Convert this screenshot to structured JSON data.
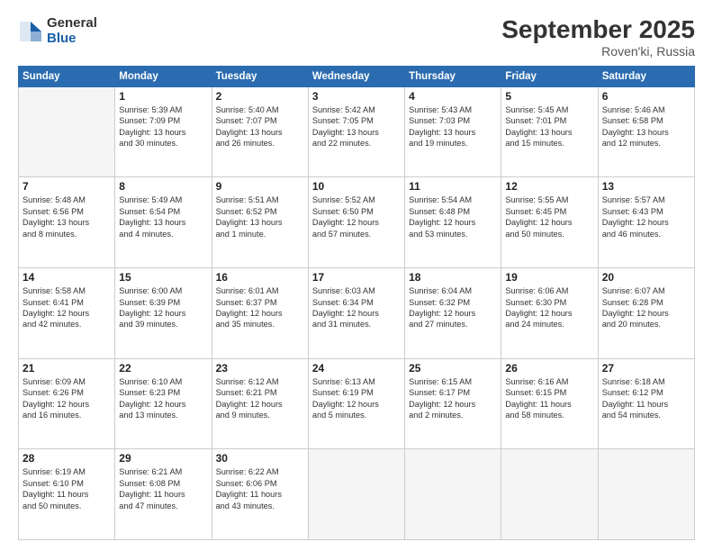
{
  "header": {
    "logo_general": "General",
    "logo_blue": "Blue",
    "month_title": "September 2025",
    "location": "Roven'ki, Russia"
  },
  "days_of_week": [
    "Sunday",
    "Monday",
    "Tuesday",
    "Wednesday",
    "Thursday",
    "Friday",
    "Saturday"
  ],
  "weeks": [
    [
      {
        "day": "",
        "info": ""
      },
      {
        "day": "1",
        "info": "Sunrise: 5:39 AM\nSunset: 7:09 PM\nDaylight: 13 hours\nand 30 minutes."
      },
      {
        "day": "2",
        "info": "Sunrise: 5:40 AM\nSunset: 7:07 PM\nDaylight: 13 hours\nand 26 minutes."
      },
      {
        "day": "3",
        "info": "Sunrise: 5:42 AM\nSunset: 7:05 PM\nDaylight: 13 hours\nand 22 minutes."
      },
      {
        "day": "4",
        "info": "Sunrise: 5:43 AM\nSunset: 7:03 PM\nDaylight: 13 hours\nand 19 minutes."
      },
      {
        "day": "5",
        "info": "Sunrise: 5:45 AM\nSunset: 7:01 PM\nDaylight: 13 hours\nand 15 minutes."
      },
      {
        "day": "6",
        "info": "Sunrise: 5:46 AM\nSunset: 6:58 PM\nDaylight: 13 hours\nand 12 minutes."
      }
    ],
    [
      {
        "day": "7",
        "info": "Sunrise: 5:48 AM\nSunset: 6:56 PM\nDaylight: 13 hours\nand 8 minutes."
      },
      {
        "day": "8",
        "info": "Sunrise: 5:49 AM\nSunset: 6:54 PM\nDaylight: 13 hours\nand 4 minutes."
      },
      {
        "day": "9",
        "info": "Sunrise: 5:51 AM\nSunset: 6:52 PM\nDaylight: 13 hours\nand 1 minute."
      },
      {
        "day": "10",
        "info": "Sunrise: 5:52 AM\nSunset: 6:50 PM\nDaylight: 12 hours\nand 57 minutes."
      },
      {
        "day": "11",
        "info": "Sunrise: 5:54 AM\nSunset: 6:48 PM\nDaylight: 12 hours\nand 53 minutes."
      },
      {
        "day": "12",
        "info": "Sunrise: 5:55 AM\nSunset: 6:45 PM\nDaylight: 12 hours\nand 50 minutes."
      },
      {
        "day": "13",
        "info": "Sunrise: 5:57 AM\nSunset: 6:43 PM\nDaylight: 12 hours\nand 46 minutes."
      }
    ],
    [
      {
        "day": "14",
        "info": "Sunrise: 5:58 AM\nSunset: 6:41 PM\nDaylight: 12 hours\nand 42 minutes."
      },
      {
        "day": "15",
        "info": "Sunrise: 6:00 AM\nSunset: 6:39 PM\nDaylight: 12 hours\nand 39 minutes."
      },
      {
        "day": "16",
        "info": "Sunrise: 6:01 AM\nSunset: 6:37 PM\nDaylight: 12 hours\nand 35 minutes."
      },
      {
        "day": "17",
        "info": "Sunrise: 6:03 AM\nSunset: 6:34 PM\nDaylight: 12 hours\nand 31 minutes."
      },
      {
        "day": "18",
        "info": "Sunrise: 6:04 AM\nSunset: 6:32 PM\nDaylight: 12 hours\nand 27 minutes."
      },
      {
        "day": "19",
        "info": "Sunrise: 6:06 AM\nSunset: 6:30 PM\nDaylight: 12 hours\nand 24 minutes."
      },
      {
        "day": "20",
        "info": "Sunrise: 6:07 AM\nSunset: 6:28 PM\nDaylight: 12 hours\nand 20 minutes."
      }
    ],
    [
      {
        "day": "21",
        "info": "Sunrise: 6:09 AM\nSunset: 6:26 PM\nDaylight: 12 hours\nand 16 minutes."
      },
      {
        "day": "22",
        "info": "Sunrise: 6:10 AM\nSunset: 6:23 PM\nDaylight: 12 hours\nand 13 minutes."
      },
      {
        "day": "23",
        "info": "Sunrise: 6:12 AM\nSunset: 6:21 PM\nDaylight: 12 hours\nand 9 minutes."
      },
      {
        "day": "24",
        "info": "Sunrise: 6:13 AM\nSunset: 6:19 PM\nDaylight: 12 hours\nand 5 minutes."
      },
      {
        "day": "25",
        "info": "Sunrise: 6:15 AM\nSunset: 6:17 PM\nDaylight: 12 hours\nand 2 minutes."
      },
      {
        "day": "26",
        "info": "Sunrise: 6:16 AM\nSunset: 6:15 PM\nDaylight: 11 hours\nand 58 minutes."
      },
      {
        "day": "27",
        "info": "Sunrise: 6:18 AM\nSunset: 6:12 PM\nDaylight: 11 hours\nand 54 minutes."
      }
    ],
    [
      {
        "day": "28",
        "info": "Sunrise: 6:19 AM\nSunset: 6:10 PM\nDaylight: 11 hours\nand 50 minutes."
      },
      {
        "day": "29",
        "info": "Sunrise: 6:21 AM\nSunset: 6:08 PM\nDaylight: 11 hours\nand 47 minutes."
      },
      {
        "day": "30",
        "info": "Sunrise: 6:22 AM\nSunset: 6:06 PM\nDaylight: 11 hours\nand 43 minutes."
      },
      {
        "day": "",
        "info": ""
      },
      {
        "day": "",
        "info": ""
      },
      {
        "day": "",
        "info": ""
      },
      {
        "day": "",
        "info": ""
      }
    ]
  ]
}
